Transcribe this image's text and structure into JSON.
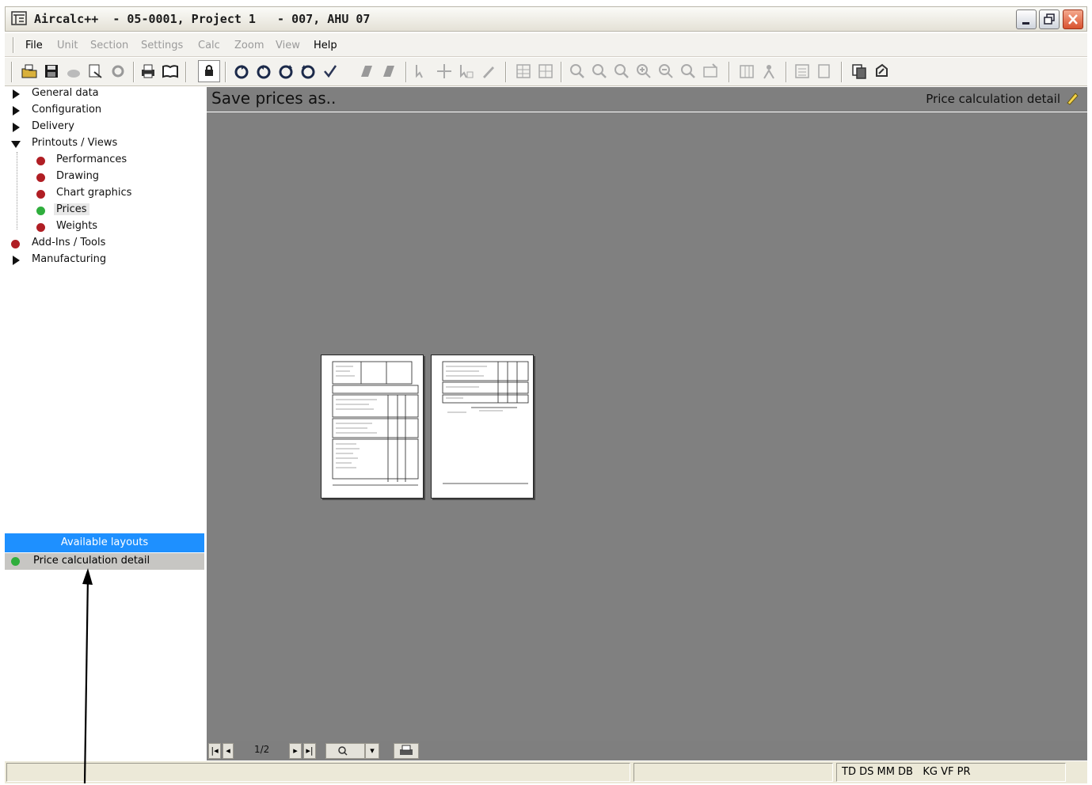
{
  "window": {
    "title": "Aircalc++  - 05-0001, Project 1   - 007, AHU 07"
  },
  "menu": [
    {
      "label": "File",
      "enabled": true
    },
    {
      "label": "Unit",
      "enabled": false
    },
    {
      "label": "Section",
      "enabled": false
    },
    {
      "label": "Settings",
      "enabled": false
    },
    {
      "label": "Calc",
      "enabled": false
    },
    {
      "label": "Zoom",
      "enabled": false
    },
    {
      "label": "View",
      "enabled": false
    },
    {
      "label": "Help",
      "enabled": true
    }
  ],
  "toolbar_icons": [
    "open-folder-icon",
    "save-icon",
    "cloud-icon",
    "export-icon",
    "settings-icon",
    "print-icon",
    "book-icon",
    "lock-icon",
    "rotate-icon-1",
    "rotate-icon-2",
    "rotate-icon-3",
    "rotate-icon-4",
    "check-icon",
    "shape-icon-1",
    "shape-icon-2",
    "cursor-icon-1",
    "move-icon",
    "cursor-icon-2",
    "pen-icon",
    "table-icon",
    "grid-icon",
    "zoom-icon-1",
    "zoom-icon-2",
    "zoom-icon-3",
    "zoom-in-icon",
    "zoom-out-icon",
    "zoom-fit-icon",
    "zoom-extent-icon",
    "columns-icon",
    "person-icon",
    "list-icon",
    "document-icon",
    "copy-icon",
    "refresh-icon"
  ],
  "tree": {
    "items": [
      {
        "label": "General data",
        "marker": "arrow-right"
      },
      {
        "label": "Configuration",
        "marker": "arrow-right"
      },
      {
        "label": "Delivery",
        "marker": "arrow-right"
      },
      {
        "label": "Printouts / Views",
        "marker": "arrow-down"
      },
      {
        "label": "Performances",
        "marker": "red-dot",
        "child": true
      },
      {
        "label": "Drawing",
        "marker": "red-dot",
        "child": true
      },
      {
        "label": "Chart graphics",
        "marker": "red-dot",
        "child": true
      },
      {
        "label": "Prices",
        "marker": "green-dot",
        "child": true,
        "selected": true
      },
      {
        "label": "Weights",
        "marker": "red-dot",
        "child": true
      },
      {
        "label": "Add-Ins / Tools",
        "marker": "red-dot"
      },
      {
        "label": "Manufacturing",
        "marker": "arrow-right"
      }
    ]
  },
  "layouts": {
    "header": "Available layouts",
    "selected": "Price calculation detail"
  },
  "preview": {
    "title": "Save prices as..",
    "layout_name": "Price calculation detail",
    "page_indicator": "1/2"
  },
  "status": {
    "panel1": "",
    "panel2": "",
    "flags": "TD DS MM DB   KG VF PR"
  },
  "colors": {
    "selection_blue": "#1e90ff",
    "preview_grey": "#808080",
    "dot_red": "#b01e24",
    "dot_green": "#2fae3d"
  }
}
